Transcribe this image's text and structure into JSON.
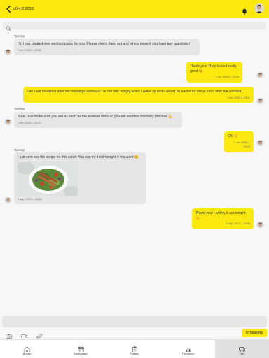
{
  "header": {
    "title": "сб 4.2.2023",
    "back_icon": "back-arrow-icon",
    "bell_icon": "bell-icon",
    "accent": "#fbe80f"
  },
  "search": {
    "placeholder": "",
    "value": ""
  },
  "messages": [
    {
      "direction": "in",
      "sender": "Тренер",
      "text": "Hi, I just created new workout plans for you. Please check them out and let me know if you have any questions!",
      "time": "7 окт. 2020 г., 13:08"
    },
    {
      "direction": "out",
      "text": "Thank you! They looked really good 😊",
      "time": "7 окт. 2020 г., 13:09"
    },
    {
      "direction": "out",
      "text": "Can I eat breakfast after the mornings workout? I'm not that hungry when I wake up and it would be easier for me to eat it after the workout.",
      "time": "7 окт. 2020 г., 13:11"
    },
    {
      "direction": "in",
      "sender": "Тренер",
      "text": "Sure. Just make sure you eat as soon as the workout ends so you will start the recovery process 💪",
      "time": "7 окт. 2020 г., 13:12"
    },
    {
      "direction": "out",
      "text": "OK 🙂",
      "time": "7 окт. 2020 г., 13:13"
    },
    {
      "direction": "in",
      "sender": "Тренер",
      "text": "I just sent you the recipe for this salad. You can try it out tonight if you want 😊",
      "time": "8 апр. 2022 г., 18:50"
    },
    {
      "direction": "out",
      "text": "Thank you! I will try it out tonight 💪",
      "time": "8 апр. 2022 г., 18:55"
    }
  ],
  "composer": {
    "placeholder": "",
    "value": "",
    "send_label": "Отправить"
  },
  "tabs": [
    {
      "label": "Дневн",
      "icon": "home-icon"
    },
    {
      "label": "Календарь",
      "icon": "calendar-icon"
    },
    {
      "label": "Планы",
      "icon": "clipboard-icon"
    },
    {
      "label": "Прогресс",
      "icon": "chart-icon"
    },
    {
      "label": "Чат",
      "icon": "chat-icon",
      "active": true
    }
  ]
}
